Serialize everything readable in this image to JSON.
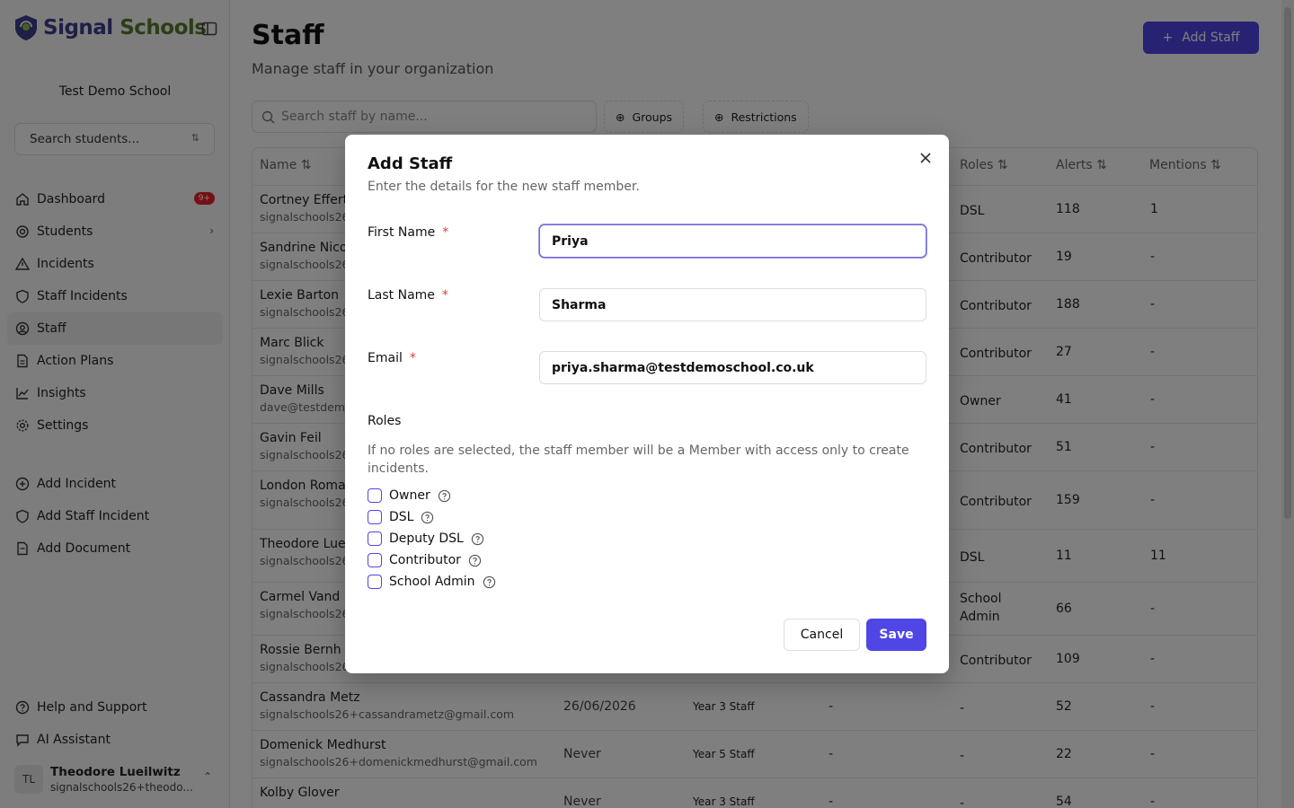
{
  "sidebar": {
    "brand": {
      "name_a": "Signal",
      "name_b": "Schools"
    },
    "school_name": "Test Demo School",
    "search_placeholder": "Search students...",
    "nav": [
      {
        "label": "Dashboard",
        "icon": "home-icon",
        "badge": "9+"
      },
      {
        "label": "Students",
        "icon": "target-icon",
        "has_submenu": true
      },
      {
        "label": "Incidents",
        "icon": "warning-icon"
      },
      {
        "label": "Staff Incidents",
        "icon": "shield-icon"
      },
      {
        "label": "Staff",
        "icon": "user-circle-icon",
        "active": true
      },
      {
        "label": "Action Plans",
        "icon": "document-icon"
      },
      {
        "label": "Insights",
        "icon": "chart-line-icon"
      },
      {
        "label": "Settings",
        "icon": "gear-icon"
      }
    ],
    "quick_actions": [
      {
        "label": "Add Incident",
        "icon": "plus-circle-icon"
      },
      {
        "label": "Add Staff Incident",
        "icon": "shield-icon"
      },
      {
        "label": "Add Document",
        "icon": "document-icon"
      }
    ],
    "footer": [
      {
        "label": "Help and Support",
        "icon": "help-circle-icon"
      },
      {
        "label": "AI Assistant",
        "icon": "chat-icon"
      }
    ],
    "user": {
      "initials": "TL",
      "name": "Theodore Lueilwitz",
      "email": "signalschools26+theodo..."
    }
  },
  "main": {
    "title": "Staff",
    "subtitle": "Manage staff in your organization",
    "add_button": "Add Staff",
    "search_placeholder": "Search staff by name...",
    "filters": [
      "Groups",
      "Restrictions"
    ],
    "columns": {
      "name": "Name",
      "roles": "Roles",
      "alerts": "Alerts",
      "mentions": "Mentions"
    },
    "rows": [
      {
        "name": "Cortney Effert",
        "email": "signalschools26",
        "roles": "DSL",
        "alerts": "118",
        "mentions": "1"
      },
      {
        "name": "Sandrine Nico",
        "email": "signalschools26",
        "roles": "Contributor",
        "alerts": "19",
        "mentions": "-"
      },
      {
        "name": "Lexie Barton",
        "email": "signalschools26",
        "roles": "Contributor",
        "alerts": "188",
        "mentions": "-"
      },
      {
        "name": "Marc Blick",
        "email": "signalschools26",
        "roles": "Contributor",
        "alerts": "27",
        "mentions": "-"
      },
      {
        "name": "Dave Mills",
        "email": "dave@testdem",
        "roles": "Owner",
        "alerts": "41",
        "mentions": "-"
      },
      {
        "name": "Gavin Feil",
        "email": "signalschools26",
        "roles": "Contributor",
        "alerts": "51",
        "mentions": "-"
      },
      {
        "name": "London Roma",
        "email": "signalschools26",
        "roles": "Contributor",
        "alerts": "159",
        "mentions": "-"
      },
      {
        "name": "Theodore Lue",
        "email": "signalschools26",
        "roles": "DSL",
        "alerts": "11",
        "mentions": "11"
      },
      {
        "name": "Carmel Vand",
        "email": "signalschools26",
        "roles": "School Admin",
        "alerts": "66",
        "mentions": "-"
      },
      {
        "name": "Rossie Bernh",
        "email": "signalschools26",
        "roles": "Contributor",
        "alerts": "109",
        "mentions": "-"
      },
      {
        "name": "Cassandra Metz",
        "email": "signalschools26+cassandrametz@gmail.com",
        "last_active": "26/06/2026",
        "group": "Year 3 Staff",
        "restrictions": "-",
        "roles": "-",
        "alerts": "52",
        "mentions": "-"
      },
      {
        "name": "Domenick Medhurst",
        "email": "signalschools26+domenickmedhurst@gmail.com",
        "last_active": "Never",
        "group": "Year 5 Staff",
        "restrictions": "-",
        "roles": "-",
        "alerts": "22",
        "mentions": "-"
      },
      {
        "name": "Kolby Glover",
        "email": "",
        "last_active": "Never",
        "group": "Year 3 Staff",
        "restrictions": "-",
        "roles": "-",
        "alerts": "54",
        "mentions": "-"
      }
    ]
  },
  "modal": {
    "title": "Add Staff",
    "description": "Enter the details for the new staff member.",
    "fields": {
      "first_name": {
        "label": "First Name",
        "value": "Priya"
      },
      "last_name": {
        "label": "Last Name",
        "value": "Sharma"
      },
      "email": {
        "label": "Email",
        "value": "priya.sharma@testdemoschool.co.uk"
      }
    },
    "required_mark": "*",
    "roles_title": "Roles",
    "roles_description": "If no roles are selected, the staff member will be a Member with access only to create incidents.",
    "roles": [
      "Owner",
      "DSL",
      "Deputy DSL",
      "Contributor",
      "School Admin"
    ],
    "cancel_label": "Cancel",
    "save_label": "Save"
  },
  "colors": {
    "primary": "#4f46e5",
    "danger": "#e23b3b",
    "overlay": "rgba(0,0,0,0.5)"
  }
}
